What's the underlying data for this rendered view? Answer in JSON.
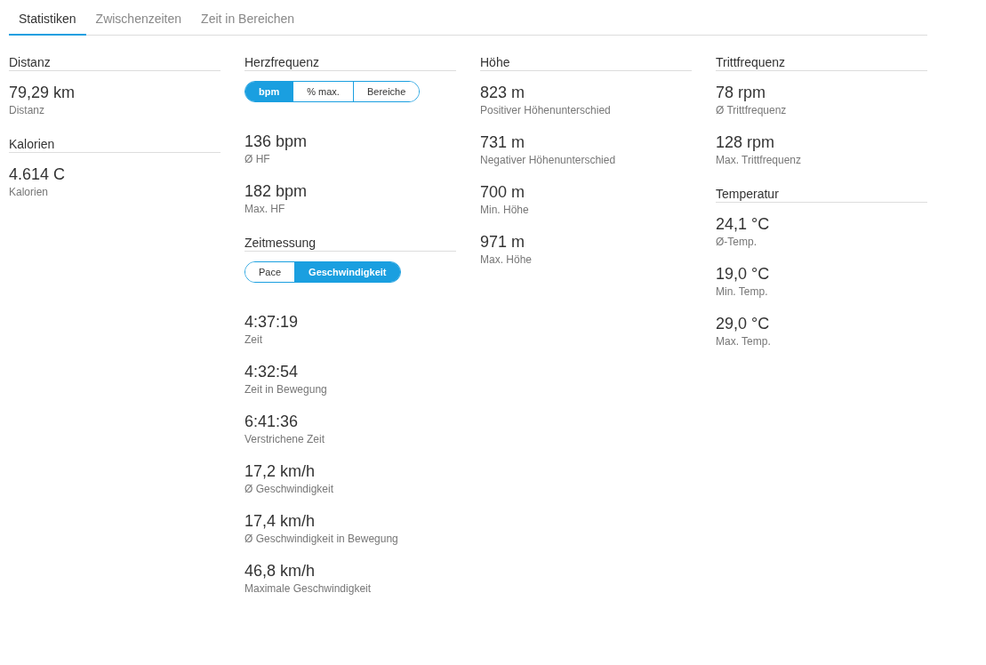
{
  "tabs": [
    {
      "label": "Statistiken",
      "selected": true
    },
    {
      "label": "Zwischenzeiten",
      "selected": false
    },
    {
      "label": "Zeit in Bereichen",
      "selected": false
    }
  ],
  "columns": [
    {
      "sections": [
        {
          "title": "Distanz",
          "stats": [
            {
              "value": "79,29 km",
              "label": "Distanz"
            }
          ]
        },
        {
          "title": "Kalorien",
          "stats": [
            {
              "value": "4.614 C",
              "label": "Kalorien"
            }
          ]
        }
      ]
    },
    {
      "sections": [
        {
          "title": "Herzfrequenz",
          "toggle": [
            {
              "label": "bpm",
              "selected": true
            },
            {
              "label": "% max.",
              "selected": false
            },
            {
              "label": "Bereiche",
              "selected": false
            }
          ],
          "stats": [
            {
              "value": "136 bpm",
              "label": "Ø HF"
            },
            {
              "value": "182 bpm",
              "label": "Max. HF"
            }
          ]
        },
        {
          "title": "Zeitmessung",
          "toggle": [
            {
              "label": "Pace",
              "selected": false
            },
            {
              "label": "Geschwindigkeit",
              "selected": true
            }
          ],
          "stats": [
            {
              "value": "4:37:19",
              "label": "Zeit"
            },
            {
              "value": "4:32:54",
              "label": "Zeit in Bewegung"
            },
            {
              "value": "6:41:36",
              "label": "Verstrichene Zeit"
            },
            {
              "value": "17,2 km/h",
              "label": "Ø Geschwindigkeit"
            },
            {
              "value": "17,4 km/h",
              "label": "Ø Geschwindigkeit in Bewegung"
            },
            {
              "value": "46,8 km/h",
              "label": "Maximale Geschwindigkeit"
            }
          ]
        }
      ]
    },
    {
      "sections": [
        {
          "title": "Höhe",
          "stats": [
            {
              "value": "823 m",
              "label": "Positiver Höhenunterschied"
            },
            {
              "value": "731 m",
              "label": "Negativer Höhenunterschied"
            },
            {
              "value": "700 m",
              "label": "Min. Höhe"
            },
            {
              "value": "971 m",
              "label": "Max. Höhe"
            }
          ]
        }
      ]
    },
    {
      "sections": [
        {
          "title": "Trittfrequenz",
          "stats": [
            {
              "value": "78 rpm",
              "label": "Ø Trittfrequenz"
            },
            {
              "value": "128 rpm",
              "label": "Max. Trittfrequenz"
            }
          ]
        },
        {
          "title": "Temperatur",
          "stats": [
            {
              "value": "24,1 °C",
              "label": "Ø-Temp."
            },
            {
              "value": "19,0 °C",
              "label": "Min. Temp."
            },
            {
              "value": "29,0 °C",
              "label": "Max. Temp."
            }
          ]
        }
      ]
    }
  ]
}
